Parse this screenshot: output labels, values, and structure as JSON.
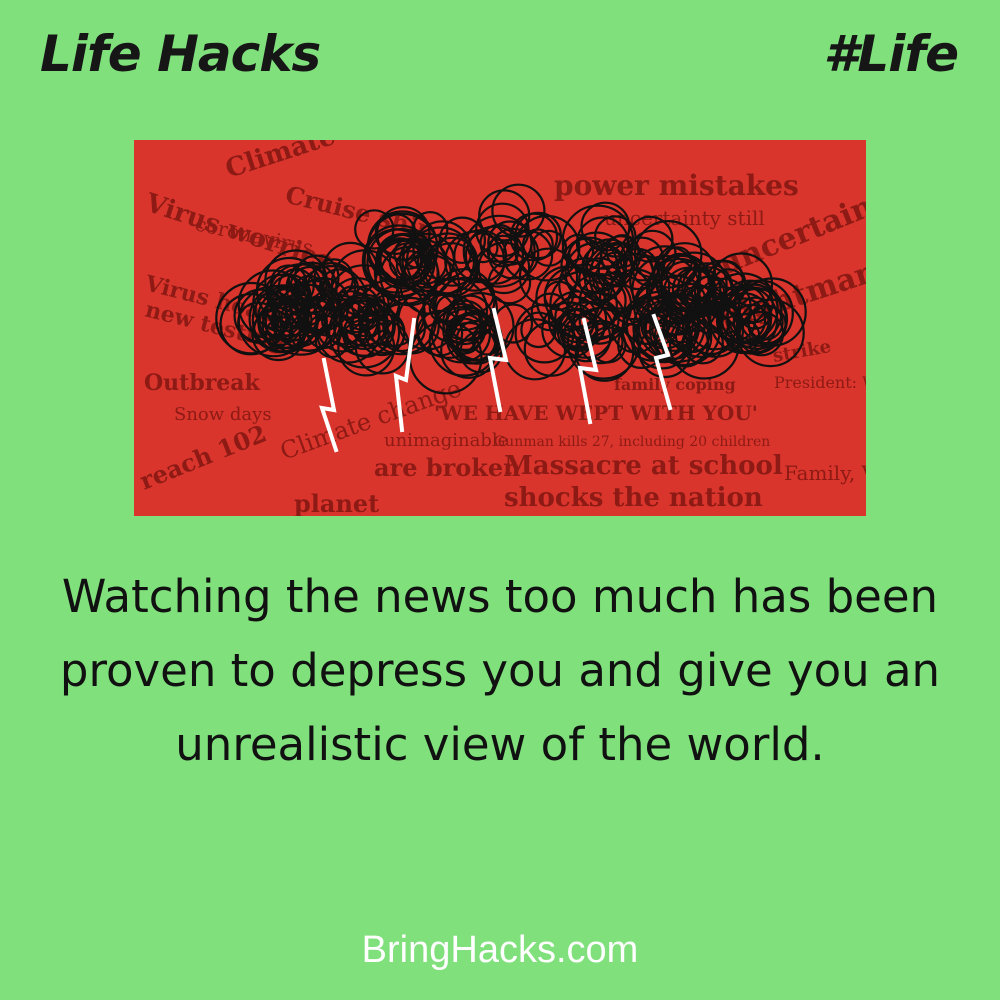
{
  "header": {
    "title": "Life Hacks",
    "tag": "#Life"
  },
  "image": {
    "headlines": [
      "Climate change",
      "Cruise ship",
      "coronavirus",
      "Virus worries",
      "Virus hoax",
      "new testing",
      "power mistakes",
      "uncertainty still",
      "uncertain",
      "nightmare",
      "strike",
      "Outbreak",
      "Snow days",
      "Climate change",
      "President: We are here for you",
      "Massacre at school",
      "shocks the nation",
      "'WE HAVE WEPT WITH YOU'",
      "unimaginable",
      "are broken",
      "Family, Victims",
      "reach 102",
      "Gunman kills 27, including 20 children",
      "family coping",
      "planet"
    ],
    "accent_color": "#d9352c",
    "cloud_color": "#111111",
    "lightning_color": "#ffffff"
  },
  "body": {
    "text": "Watching the news too much has been proven to depress you and give you an unrealistic view of the world."
  },
  "footer": {
    "site": "BringHacks.com"
  }
}
